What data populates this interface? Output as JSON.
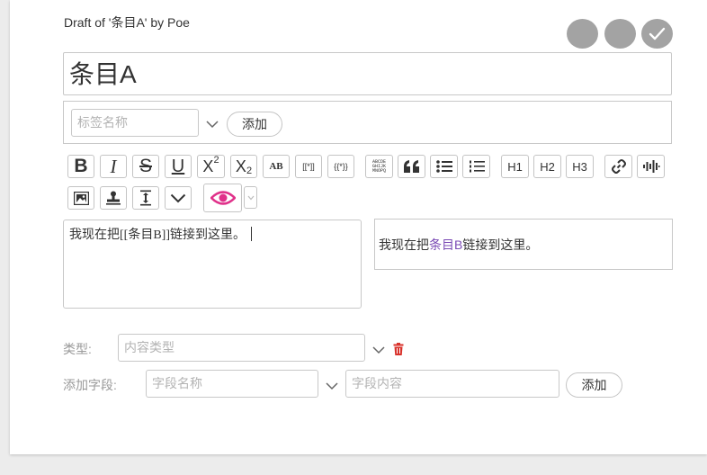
{
  "draft_label": "Draft of '条目A' by Poe",
  "title": "条目A",
  "tags": {
    "placeholder": "标签名称",
    "add_label": "添加"
  },
  "toolbar": {
    "bold": "B",
    "italic": "I",
    "strike": "S",
    "underline": "U",
    "superscript_base": "X",
    "superscript_exp": "2",
    "subscript_base": "X",
    "subscript_idx": "2",
    "small_caps": "AB",
    "wiki_link": "[[*]]",
    "macro": "{{*}}",
    "monospace_lines": [
      "ABCDE",
      "GHIJK",
      "MNOPQ"
    ],
    "h1": "H1",
    "h2": "H2",
    "h3": "H3",
    "icons": [
      "quote-icon",
      "bulleted-list-icon",
      "numbered-list-icon",
      "link-icon",
      "audio-waveform-icon",
      "image-icon",
      "stamp-icon",
      "spacing-icon",
      "chevron-down-icon",
      "eye-icon"
    ]
  },
  "editor": {
    "text": "我现在把[[条目B]]链接到这里。"
  },
  "preview": {
    "before": "我现在把",
    "link": "条目B",
    "after": "链接到这里。"
  },
  "type_row": {
    "label": "类型:",
    "placeholder": "内容类型"
  },
  "field_row": {
    "label": "添加字段:",
    "name_placeholder": "字段名称",
    "value_placeholder": "字段内容",
    "add_label": "添加"
  },
  "colors": {
    "accent_eye": "#e0318a",
    "delete_red": "#d9322b",
    "link_purple": "#7b4bb5",
    "circle_gray": "#a3a3a3"
  }
}
